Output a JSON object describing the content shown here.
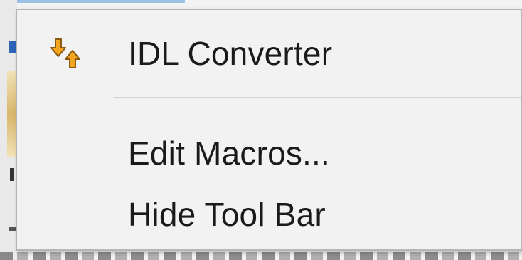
{
  "context_menu": {
    "items": [
      {
        "label": "IDL Converter",
        "icon": "arrows-converter-icon"
      },
      {
        "label": "Edit Macros..."
      },
      {
        "label": "Hide Tool Bar"
      }
    ]
  },
  "colors": {
    "menu_background": "#f2f2f2",
    "menu_border": "#b5b5b5",
    "separator": "#d3d3d3",
    "text": "#1a1a1a",
    "icon_fill": "#f3a520"
  }
}
